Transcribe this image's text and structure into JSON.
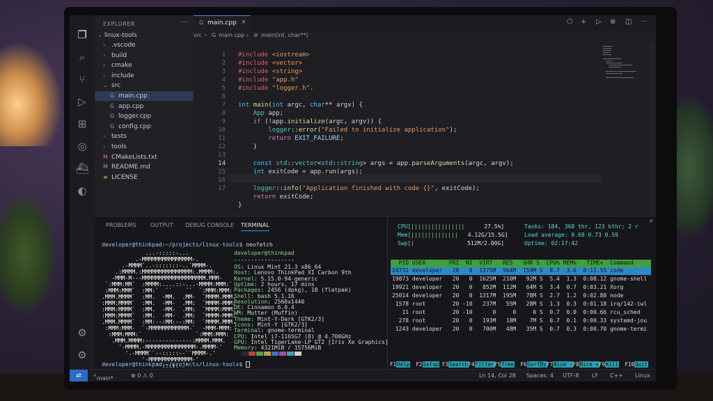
{
  "explorer": {
    "title": "EXPLORER",
    "root": "linux-tools",
    "items": [
      {
        "label": ".vscode",
        "kind": "folder"
      },
      {
        "label": "build",
        "kind": "folder"
      },
      {
        "label": "cmake",
        "kind": "folder"
      },
      {
        "label": "include",
        "kind": "folder"
      },
      {
        "label": "src",
        "kind": "folder-open"
      },
      {
        "label": "main.cpp",
        "kind": "cpp"
      },
      {
        "label": "app.cpp",
        "kind": "cpp"
      },
      {
        "label": "logger.cpp",
        "kind": "cpp"
      },
      {
        "label": "config.cpp",
        "kind": "cpp"
      },
      {
        "label": "tests",
        "kind": "folder"
      },
      {
        "label": "tools",
        "kind": "folder"
      },
      {
        "label": "CMakeLists.txt",
        "kind": "txt"
      },
      {
        "label": "README.md",
        "kind": "md"
      },
      {
        "label": "LICENSE",
        "kind": "lic"
      }
    ]
  },
  "tab": {
    "label": "main.cpp",
    "close": "×"
  },
  "breadcrumb": {
    "folder": "src",
    "file": "main.cpp",
    "symbol": "main(int, char**)"
  },
  "editor": {
    "current_line": 14,
    "line_numbers": [
      "1",
      "2",
      "3",
      "4",
      "5",
      "6",
      "7",
      "8",
      "9",
      "10",
      "11",
      "12",
      "13",
      "14",
      "15",
      "16",
      "17"
    ]
  },
  "panel": {
    "tabs": [
      "PROBLEMS",
      "OUTPUT",
      "DEBUG CONSOLE",
      "TERMINAL"
    ],
    "prompt": "developer@thinkpad:~/projects/linux-tools$",
    "command": "neofetch",
    "user_host": "developer@thinkpad",
    "separator": "------------------",
    "info": [
      {
        "key": "OS",
        "value": "Linux Mint 21.3 x86_64"
      },
      {
        "key": "Host",
        "value": "Lenovo ThinkPad X1 Carbon 9th"
      },
      {
        "key": "Kernel",
        "value": "5.15.0-94-generic"
      },
      {
        "key": "Uptime",
        "value": "2 hours, 17 mins"
      },
      {
        "key": "Packages",
        "value": "2456 (dpkg), 18 (flatpak)"
      },
      {
        "key": "Shell",
        "value": "bash 5.1.16"
      },
      {
        "key": "Resolution",
        "value": "2560x1440"
      },
      {
        "key": "DE",
        "value": "Cinnamon 6.0.4"
      },
      {
        "key": "WM",
        "value": "Mutter (Muffin)"
      },
      {
        "key": "Theme",
        "value": "Mint-Y-Dark [GTK2/3]"
      },
      {
        "key": "Icons",
        "value": "Mint-Y [GTK2/3]"
      },
      {
        "key": "Terminal",
        "value": "gnome-terminal"
      },
      {
        "key": "CPU",
        "value": "Intel i7-1165G7 (8) @ 4.700GHz"
      },
      {
        "key": "GPU",
        "value": "Intel TigerLake-LP GT2 [Iris Xe Graphics]"
      },
      {
        "key": "Memory",
        "value": "4321MiB / 15756MiB"
      }
    ],
    "swatches": [
      "#2a2a2a",
      "#c04040",
      "#50a050",
      "#c0a040",
      "#4070c0",
      "#a050a0",
      "#40a0b0",
      "#d0d0d0"
    ]
  },
  "htop": {
    "cpu_label": "CPU[",
    "cpu_bar": "||||||||||||||||",
    "cpu_pct": "27.5%]",
    "mem_label": "Mem[",
    "mem_bar": "||||||||||||||",
    "mem_val": "4.12G/15.5G]",
    "swp_label": "Swp[",
    "swp_bar": "|",
    "swp_val": "512M/2.00G]",
    "tasks": "Tasks: 184, 368 thr, 123 kthr; 2 r",
    "load": "Load average: 0.68 0.73 0.59",
    "uptime": "Uptime: 02:17:42",
    "columns": "  PID USER       PRI  NI  VIRT   RES   SHR S  CPU% MEM%   TIME+  Command",
    "rows": [
      "24731 developer   20   0  1375M  564M  159M S  8.7  3.6  0:12.55 code",
      "19873 developer   20   0  1625M  210M   92M S  5.4  1.3  0:08.12 gnome-shell",
      "19921 developer   20   0   852M  112M   64M S  3.4  0.7  0:03.21 Xorg",
      "25014 developer   20   0  1317M  195M   78M S  2.7  1.2  0:02.88 node",
      " 1578 root        20 -10   237M   55M   28M S  1.3  0.3  0:01.18 irq/142-iwl",
      "   11 root        20 -10      0     0     0 S  0.7  0.0  0:00.66 rcu_sched",
      "  278 root        20   0   193M   18M    7M S  0.7  0.1  0:00.33 systemd-jou",
      " 1243 developer   20   0   700M   48M   35M S  0.7  0.3  0:00.70 gnome-termi"
    ],
    "fkeys": [
      {
        "key": "F1",
        "label": "Help"
      },
      {
        "key": "F2",
        "label": "Setup"
      },
      {
        "key": "F3",
        "label": "Search"
      },
      {
        "key": "F4",
        "label": "Filter"
      },
      {
        "key": "F5",
        "label": "Tree"
      },
      {
        "key": "F6",
        "label": "SortBy"
      },
      {
        "key": "F7",
        "label": "Nice -"
      },
      {
        "key": "F8",
        "label": "Nice +"
      },
      {
        "key": "F9",
        "label": "Kill"
      },
      {
        "key": "F10",
        "label": "Quit"
      }
    ]
  },
  "status": {
    "branch": "main*",
    "problems": "⊗ 0 ⚠ 0",
    "position": "Ln 14, Col 28",
    "spaces": "Spaces: 4",
    "encoding": "UTF-8",
    "eol": "LF",
    "language": "C++",
    "os": "Linux"
  },
  "colors": {
    "accent": "#2b6cc4",
    "htop_header": "#3fa040",
    "htop_selected": "#2e88c8"
  }
}
